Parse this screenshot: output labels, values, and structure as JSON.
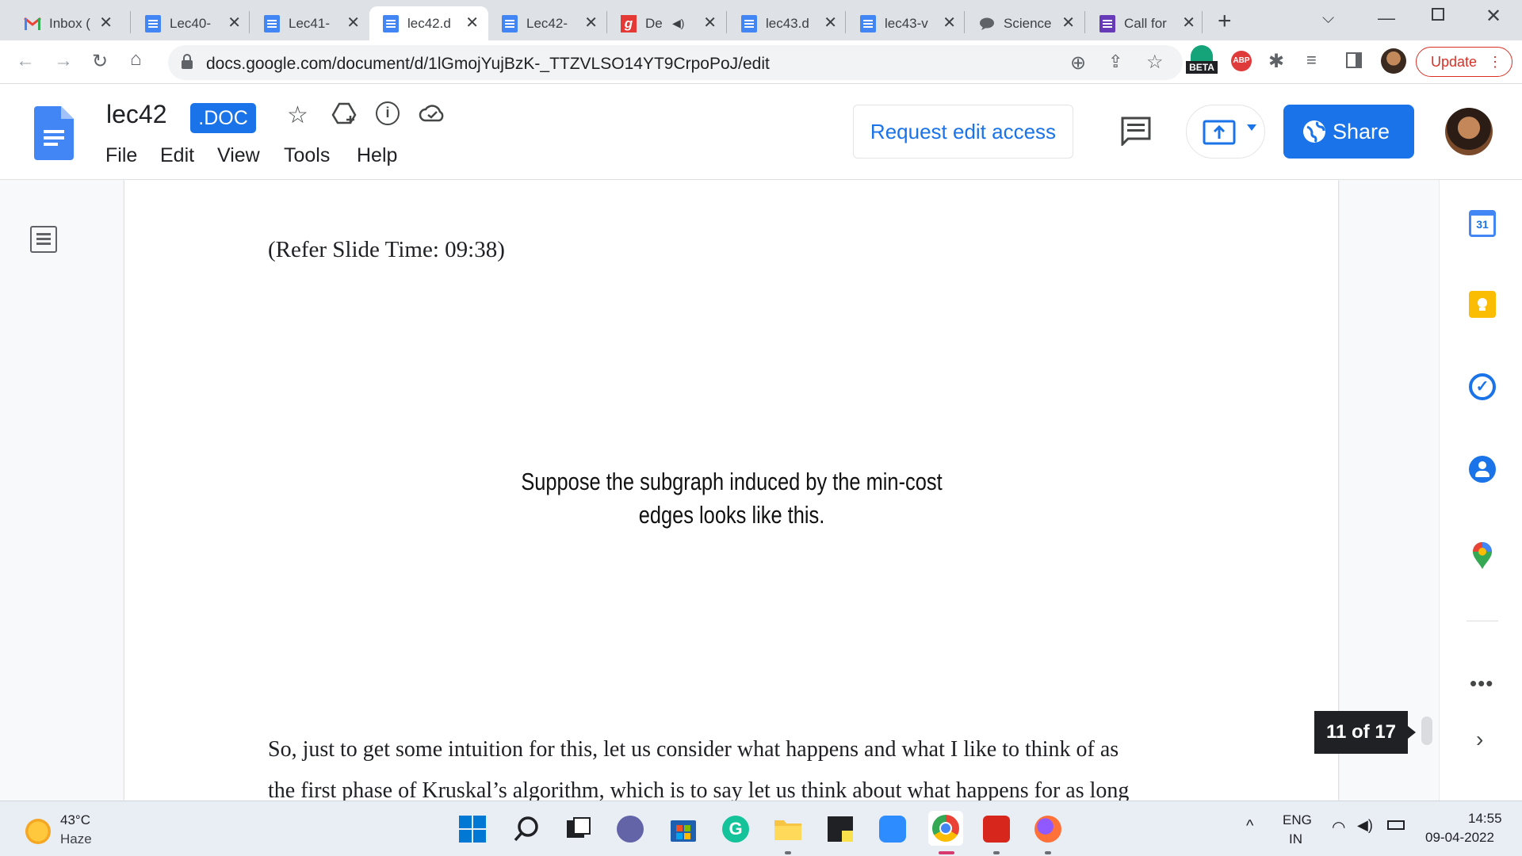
{
  "browser": {
    "tabs": [
      {
        "label": "Inbox (",
        "icon": "gmail-icon"
      },
      {
        "label": "Lec40-",
        "icon": "docs-icon"
      },
      {
        "label": "Lec41-",
        "icon": "docs-icon"
      },
      {
        "label": "lec42.d",
        "icon": "docs-icon"
      },
      {
        "label": "Lec42-",
        "icon": "docs-icon"
      },
      {
        "label": "De",
        "icon": "g-app-icon"
      },
      {
        "label": "lec43.d",
        "icon": "docs-icon"
      },
      {
        "label": "lec43-v",
        "icon": "docs-icon"
      },
      {
        "label": "Science",
        "icon": "chat-icon"
      },
      {
        "label": "Call for",
        "icon": "forms-icon"
      }
    ],
    "url": "docs.google.com/document/d/1lGmojYujBzK-_TTZVLSO14YT9CrpoPoJ/edit",
    "beta_badge": "BETA",
    "abp_badge": "ABP",
    "update_label": "Update"
  },
  "docs": {
    "title": "lec42",
    "badge": ".DOC",
    "menus": [
      "File",
      "Edit",
      "View",
      "Tools",
      "Help"
    ],
    "request_edit_label": "Request edit access",
    "share_label": "Share",
    "page_indicator": "11 of 17"
  },
  "document": {
    "slide_time": "(Refer Slide Time: 09:38)",
    "caption_line1": "Suppose the subgraph induced by the min-cost",
    "caption_line2": "edges looks like this.",
    "para_line1": "So, just to get some intuition for this, let us consider what happens and what I like to think of as",
    "para_line2": "the first phase of Kruskal’s algorithm, which is to say let us think about what happens for as long"
  },
  "sidepanel": {
    "calendar_day": "31"
  },
  "taskbar": {
    "weather_temp": "43°C",
    "weather_desc": "Haze",
    "lang_top": "ENG",
    "lang_bottom": "IN",
    "time": "14:55",
    "date": "09-04-2022"
  },
  "colors": {
    "accent": "#1a73e8",
    "docs_blue": "#4285f4",
    "tab_strip": "#dee1e6"
  }
}
